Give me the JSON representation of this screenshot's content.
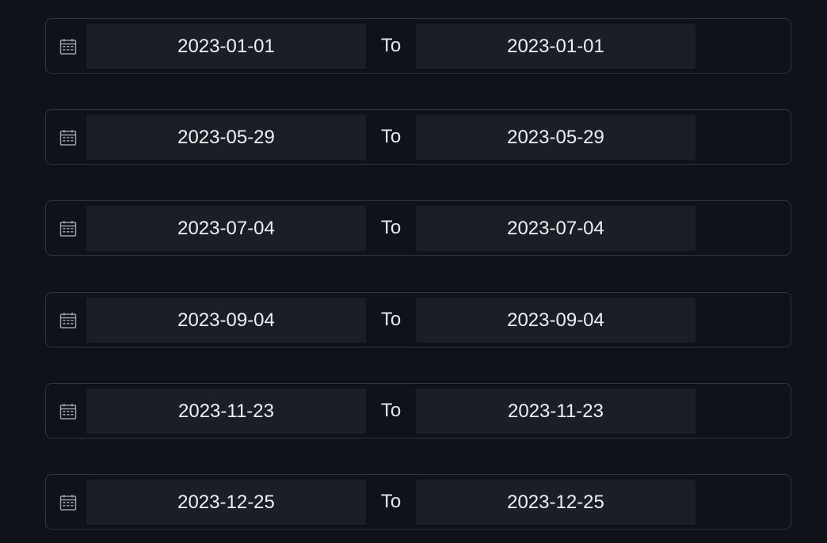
{
  "separator_label": "To",
  "icon": "calendar-icon",
  "colors": {
    "background": "#0f1219",
    "field": "#1a1e26",
    "border": "#30343d",
    "text": "#e6e8ec"
  },
  "ranges": [
    {
      "start": "2023-01-01",
      "end": "2023-01-01"
    },
    {
      "start": "2023-05-29",
      "end": "2023-05-29"
    },
    {
      "start": "2023-07-04",
      "end": "2023-07-04"
    },
    {
      "start": "2023-09-04",
      "end": "2023-09-04"
    },
    {
      "start": "2023-11-23",
      "end": "2023-11-23"
    },
    {
      "start": "2023-12-25",
      "end": "2023-12-25"
    }
  ]
}
